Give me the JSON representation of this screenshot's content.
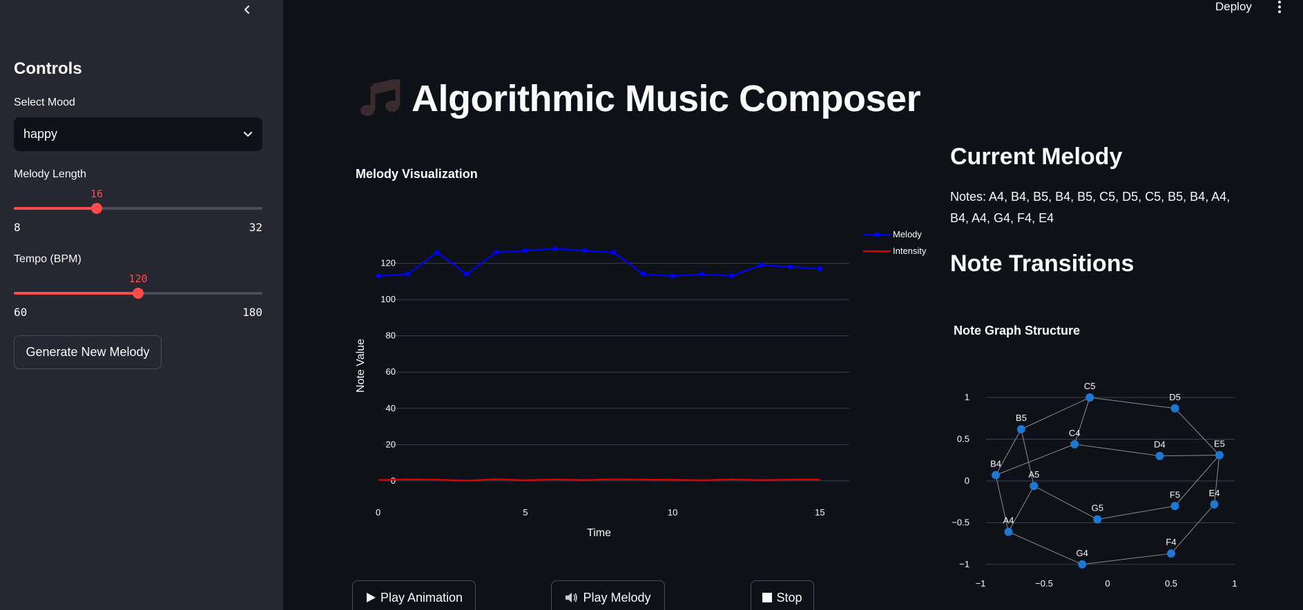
{
  "sidebar": {
    "heading": "Controls",
    "mood": {
      "label": "Select Mood",
      "value": "happy"
    },
    "length": {
      "label": "Melody Length",
      "value": 16,
      "min": 8,
      "max": 32,
      "value_text": "16",
      "min_text": "8",
      "max_text": "32"
    },
    "tempo": {
      "label": "Tempo (BPM)",
      "value": 120,
      "min": 60,
      "max": 180,
      "value_text": "120",
      "min_text": "60",
      "max_text": "180"
    },
    "generate_label": "Generate New Melody"
  },
  "topbar": {
    "deploy_label": "Deploy"
  },
  "main": {
    "title": "Algorithmic Music Composer",
    "title_icon": "music-notes-icon",
    "current_melody_heading": "Current Melody",
    "notes_text": "Notes: A4, B4, B5, B4, B5, C5, D5, C5, B5, B4, A4, B4, A4, G4, F4, E4",
    "transitions_heading": "Note Transitions",
    "buttons": {
      "play_animation": "Play Animation",
      "play_melody": "Play Melody",
      "stop": "Stop"
    }
  },
  "colors": {
    "accent": "#ff4b4b",
    "melody": "#0000ff",
    "intensity": "#e00000",
    "node": "#1f77d4"
  },
  "chart_data": [
    {
      "type": "line",
      "title": "Melody Visualization",
      "xlabel": "Time",
      "ylabel": "Note Value",
      "xlim": [
        -1,
        16
      ],
      "ylim": [
        -5,
        132
      ],
      "xticks": [
        0,
        5,
        10,
        15
      ],
      "yticks": [
        0,
        20,
        40,
        60,
        80,
        100,
        120
      ],
      "grid": true,
      "legend": "top-right",
      "x": [
        0,
        1,
        2,
        3,
        4,
        5,
        6,
        7,
        8,
        9,
        10,
        11,
        12,
        13,
        14,
        15
      ],
      "series": [
        {
          "name": "Melody",
          "markers": true,
          "values": [
            113,
            114,
            126,
            114,
            126,
            127,
            128,
            127,
            126,
            114,
            113,
            114,
            113,
            119,
            118,
            117
          ]
        },
        {
          "name": "Intensity",
          "markers": false,
          "values": [
            0.5,
            0.8,
            0.7,
            0.2,
            0.9,
            0.4,
            0.8,
            0.5,
            0.9,
            0.7,
            0.6,
            0.4,
            0.8,
            0.5,
            0.7,
            0.7
          ]
        }
      ]
    },
    {
      "type": "scatter",
      "title": "Note Graph Structure",
      "xlim": [
        -1,
        1
      ],
      "ylim": [
        -1.1,
        1.05
      ],
      "xticks": [
        -1,
        -0.5,
        0,
        0.5,
        1
      ],
      "yticks": [
        1,
        0.5,
        0,
        -0.5,
        -1
      ],
      "xtick_labels": [
        "−1",
        "−0.5",
        "0",
        "0.5",
        "1"
      ],
      "ytick_labels": [
        "1",
        "0.5",
        "0",
        "−0.5",
        "−1"
      ],
      "nodes": [
        {
          "name": "C5",
          "x": -0.14,
          "y": 1.0
        },
        {
          "name": "D5",
          "x": 0.53,
          "y": 0.87
        },
        {
          "name": "B5",
          "x": -0.68,
          "y": 0.62
        },
        {
          "name": "C4",
          "x": -0.26,
          "y": 0.44
        },
        {
          "name": "D4",
          "x": 0.41,
          "y": 0.3
        },
        {
          "name": "E5",
          "x": 0.88,
          "y": 0.31
        },
        {
          "name": "B4",
          "x": -0.88,
          "y": 0.07
        },
        {
          "name": "A5",
          "x": -0.58,
          "y": -0.06
        },
        {
          "name": "F5",
          "x": 0.53,
          "y": -0.3
        },
        {
          "name": "E4",
          "x": 0.84,
          "y": -0.28
        },
        {
          "name": "G5",
          "x": -0.08,
          "y": -0.46
        },
        {
          "name": "A4",
          "x": -0.78,
          "y": -0.61
        },
        {
          "name": "F4",
          "x": 0.5,
          "y": -0.87
        },
        {
          "name": "G4",
          "x": -0.2,
          "y": -1.0
        }
      ],
      "edges": [
        [
          "C5",
          "B5"
        ],
        [
          "C5",
          "D5"
        ],
        [
          "C5",
          "C4"
        ],
        [
          "B5",
          "B4"
        ],
        [
          "B5",
          "A5"
        ],
        [
          "C4",
          "B4"
        ],
        [
          "C4",
          "D4"
        ],
        [
          "D5",
          "E5"
        ],
        [
          "D4",
          "E5"
        ],
        [
          "B4",
          "A4"
        ],
        [
          "A5",
          "A4"
        ],
        [
          "A5",
          "G5"
        ],
        [
          "G5",
          "F5"
        ],
        [
          "F5",
          "E5"
        ],
        [
          "E5",
          "E4"
        ],
        [
          "E4",
          "F4"
        ],
        [
          "F4",
          "G4"
        ],
        [
          "A4",
          "G4"
        ]
      ]
    }
  ]
}
